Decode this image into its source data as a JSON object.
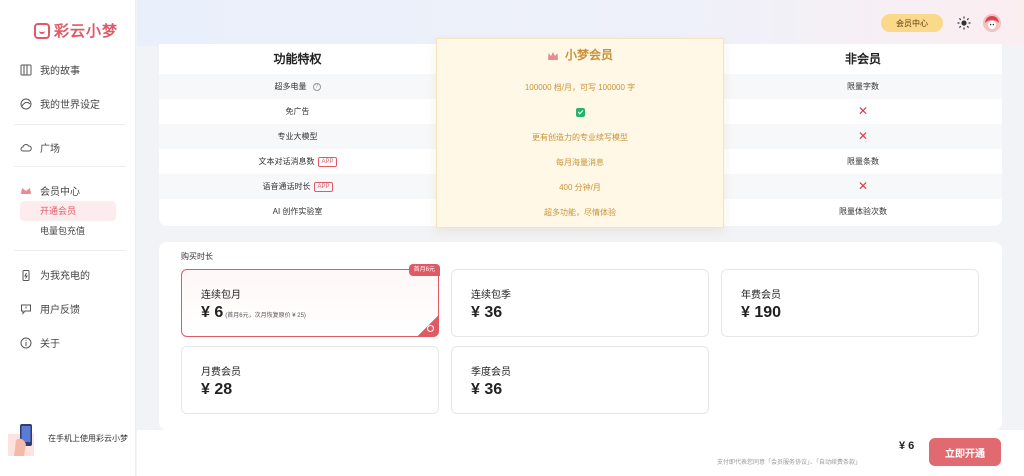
{
  "app": {
    "name": "彩云小梦"
  },
  "sidebar": {
    "items": [
      {
        "label": "我的故事",
        "icon": "book-icon"
      },
      {
        "label": "我的世界设定",
        "icon": "globe-icon"
      },
      {
        "label": "广场",
        "icon": "cloud-icon"
      },
      {
        "label": "会员中心",
        "icon": "crown-icon"
      },
      {
        "label": "为我充电的",
        "icon": "battery-icon"
      },
      {
        "label": "用户反馈",
        "icon": "feedback-icon"
      },
      {
        "label": "关于",
        "icon": "info-icon"
      }
    ],
    "sub_items": [
      {
        "label": "开通会员",
        "active": true
      },
      {
        "label": "电量包充值",
        "active": false
      }
    ],
    "promo": "在手机上使用彩云小梦"
  },
  "header": {
    "vip_center": "会员中心"
  },
  "compare": {
    "col_feature": "功能特权",
    "col_vip": "小梦会员",
    "col_free": "非会员",
    "rows": [
      {
        "feature": "超多电量",
        "vip": "100000 档/月，可写 100000 字",
        "free": "限量字数"
      },
      {
        "feature": "免广告",
        "vip": "",
        "free": ""
      },
      {
        "feature": "专业大模型",
        "vip": "更有创造力的专业续写模型",
        "free": ""
      },
      {
        "feature": "文本对话消息数",
        "vip": "每月海量消息",
        "free": "限量条数"
      },
      {
        "feature": "语音通话时长",
        "vip": "400 分钟/月",
        "free": ""
      },
      {
        "feature": "AI 创作实验室",
        "vip": "超多功能，尽情体验",
        "free": "限量体验次数"
      }
    ],
    "app_tag": "APP",
    "help_glyph": "?",
    "cross": "✕"
  },
  "purchase": {
    "label": "购买时长",
    "plans": [
      {
        "name": "连续包月",
        "price": "¥ 6",
        "note": "(首月6元，次月恢复原价 ¥ 25)",
        "badge": "首月6元"
      },
      {
        "name": "连续包季",
        "price": "¥ 36"
      },
      {
        "name": "年费会员",
        "price": "¥ 190"
      },
      {
        "name": "月费会员",
        "price": "¥ 28"
      },
      {
        "name": "季度会员",
        "price": "¥ 36"
      }
    ]
  },
  "footer": {
    "total": "¥ 6",
    "agreement": "支付即代表您同意「会员服务协议」、「自动续费条款」",
    "open_button": "立即开通"
  },
  "colors": {
    "accent": "#e05a66",
    "gold": "#c9923a",
    "vip_bg": "#fff8e6"
  }
}
